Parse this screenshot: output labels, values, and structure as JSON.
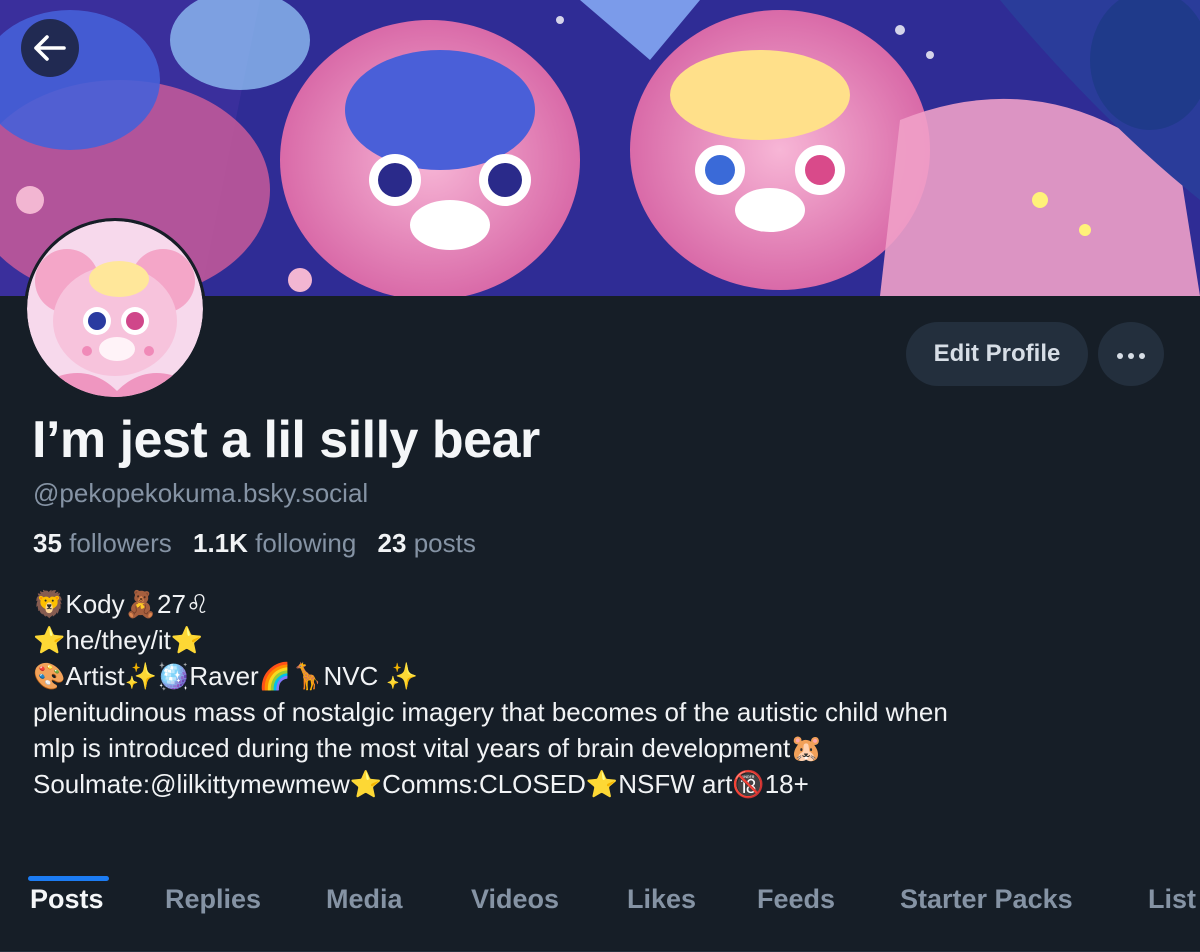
{
  "banner": {
    "alt": "illustrated banner with cartoon characters"
  },
  "nav": {
    "back_icon": "arrow-left-icon"
  },
  "profile": {
    "display_name": "I’m jest a lil silly bear",
    "handle": "@pekopekokuma.bsky.social",
    "edit_label": "Edit Profile",
    "more_icon": "ellipsis-icon"
  },
  "stats": {
    "followers_count": "35",
    "followers_label": "followers",
    "following_count": "1.1K",
    "following_label": "following",
    "posts_count": "23",
    "posts_label": "posts"
  },
  "bio": {
    "line1": "🦁Kody🧸27♌",
    "line2": "⭐he/they/it⭐",
    "line3": "🎨Artist✨🪩Raver🌈🦒NVC ✨",
    "line4": "plenitudinous mass of nostalgic imagery that becomes of the autistic child when",
    "line5": "mlp is introduced during the most vital years of brain development🐹",
    "line6": "Soulmate:@lilkittymewmew⭐Comms:CLOSED⭐NSFW art🔞18+"
  },
  "tabs": [
    {
      "label": "Posts",
      "active": true
    },
    {
      "label": "Replies"
    },
    {
      "label": "Media"
    },
    {
      "label": "Videos"
    },
    {
      "label": "Likes"
    },
    {
      "label": "Feeds"
    },
    {
      "label": "Starter Packs"
    },
    {
      "label": "List"
    }
  ],
  "colors": {
    "background": "#161e27",
    "accent": "#1c7cf3",
    "muted": "#8593a4"
  }
}
